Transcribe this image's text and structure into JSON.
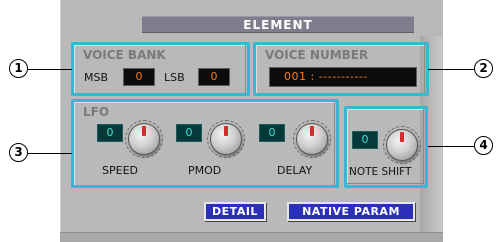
{
  "title": "ELEMENT",
  "voice_bank": {
    "label": "VOICE BANK",
    "msb_label": "MSB",
    "msb_value": "0",
    "lsb_label": "LSB",
    "lsb_value": "0"
  },
  "voice_number": {
    "label": "VOICE NUMBER",
    "value": "001 :  -----------"
  },
  "lfo": {
    "label": "LFO",
    "speed": {
      "value": "0",
      "label": "SPEED"
    },
    "pmod": {
      "value": "0",
      "label": "PMOD"
    },
    "delay": {
      "value": "0",
      "label": "DELAY"
    }
  },
  "note_shift": {
    "value": "0",
    "label": "NOTE SHIFT"
  },
  "buttons": {
    "detail": "DETAIL",
    "native_param": "NATIVE PARAM"
  },
  "callouts": {
    "c1": "1",
    "c2": "2",
    "c3": "3",
    "c4": "4"
  },
  "colors": {
    "highlight": "#38b7d3",
    "button": "#2c2fb8",
    "value_orange": "#ff7b1c",
    "value_teal": "#46e2d2"
  }
}
